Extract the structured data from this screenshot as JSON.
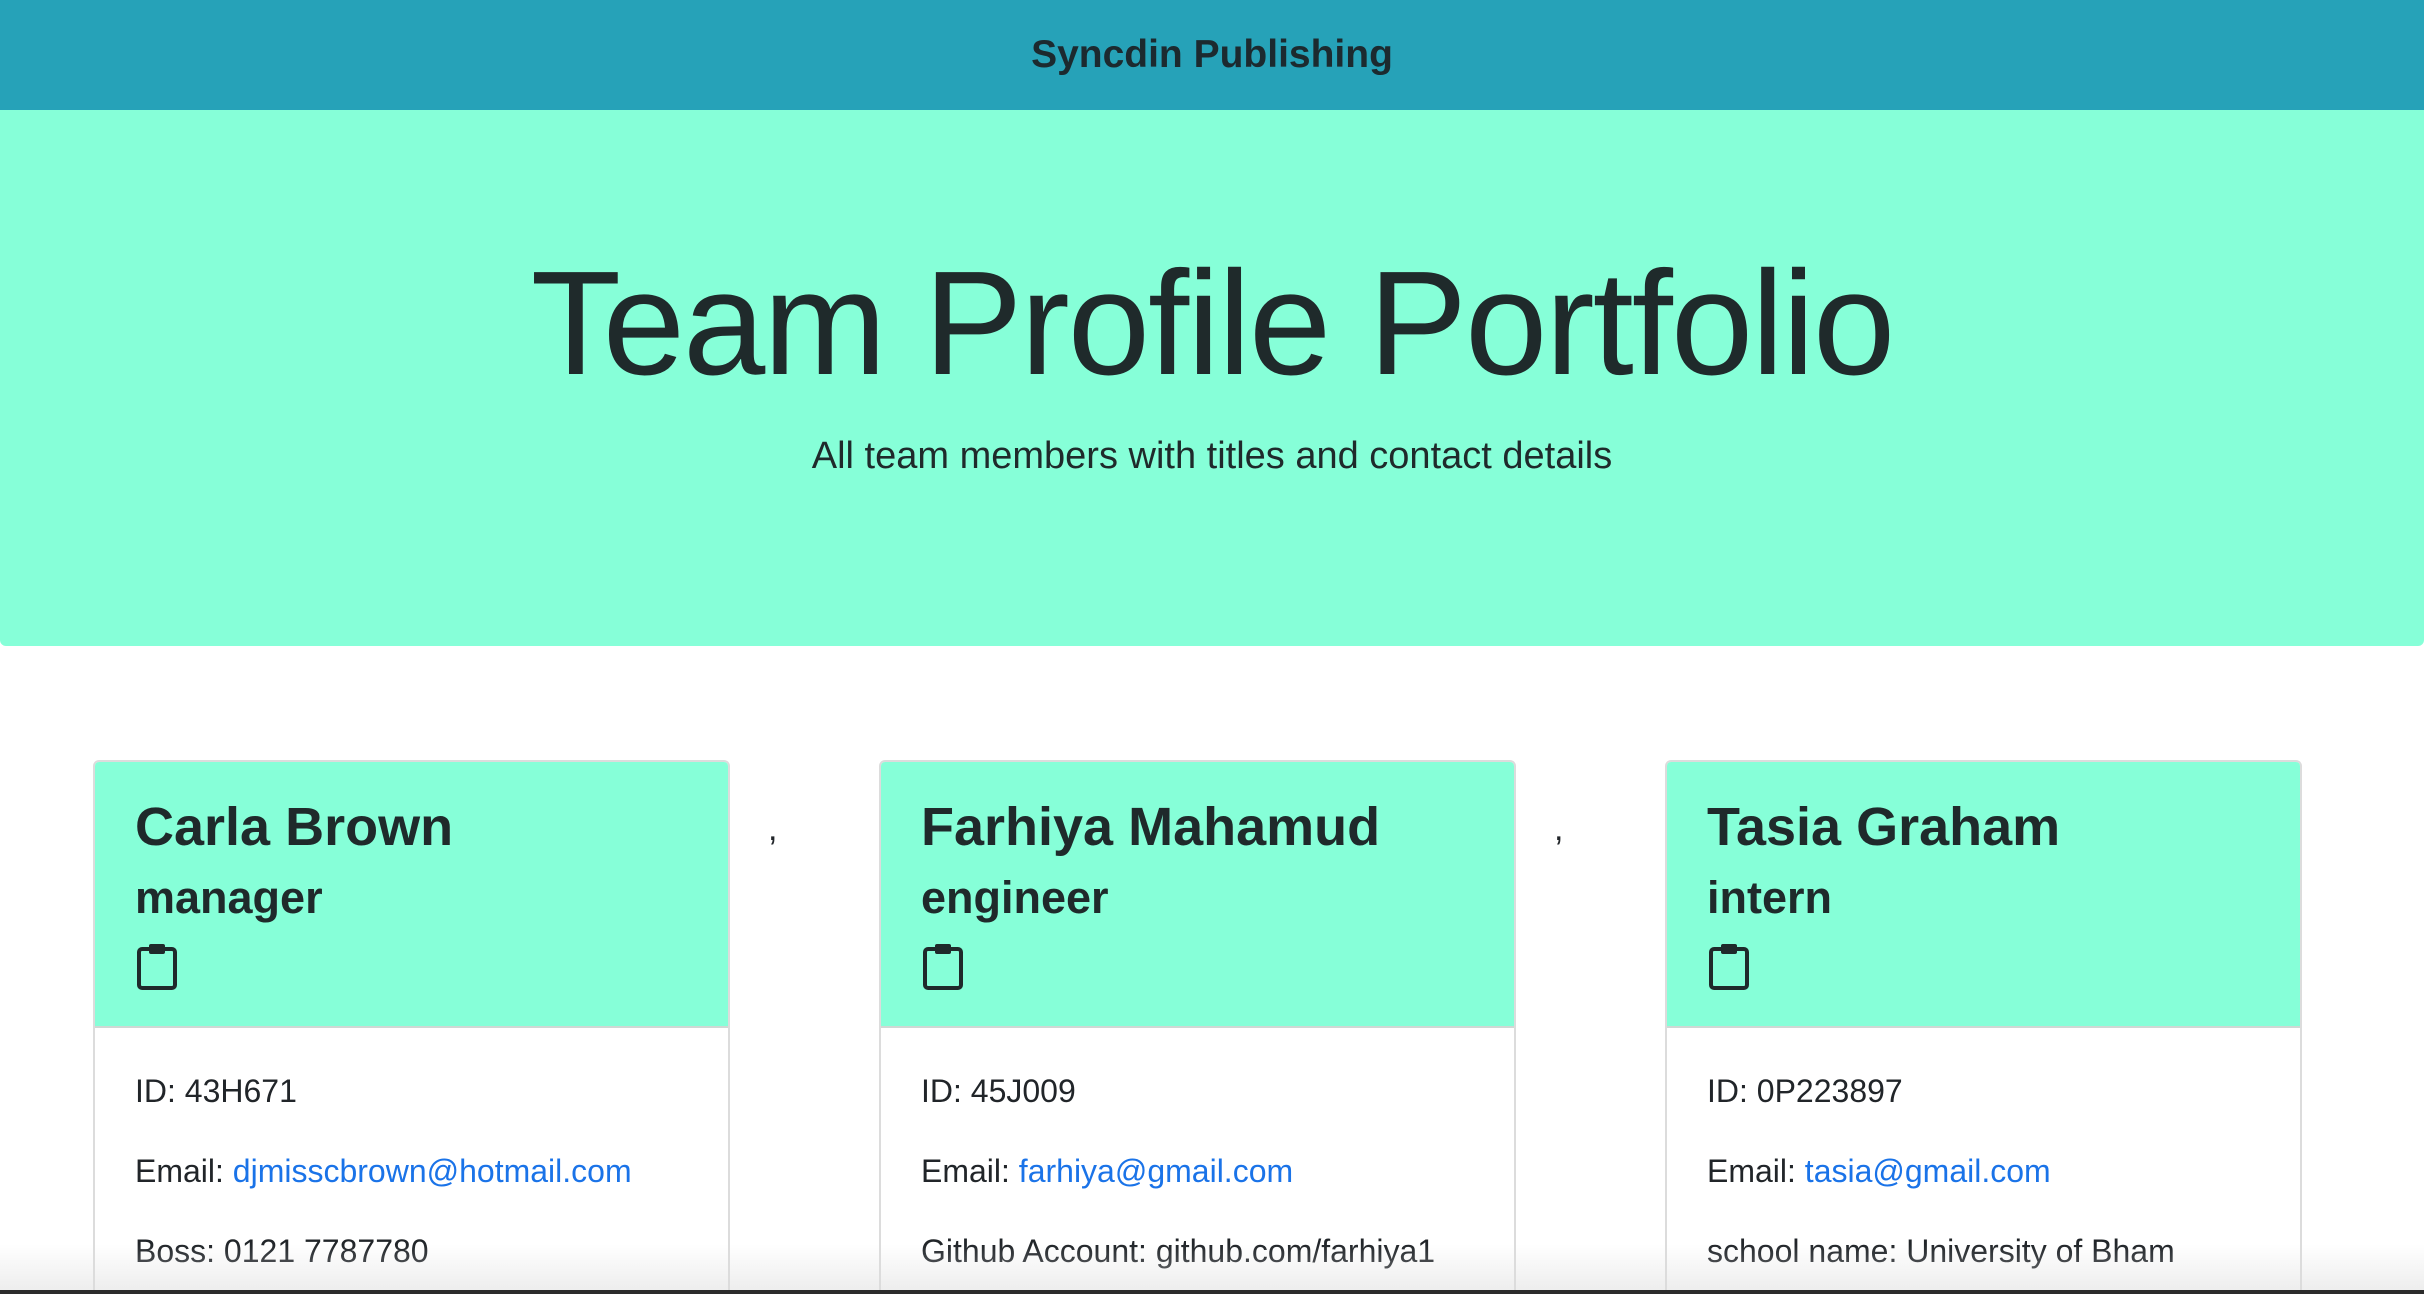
{
  "navbar": {
    "brand": "Syncdin Publishing"
  },
  "hero": {
    "title": "Team Profile Portfolio",
    "lead": "All team members with titles and contact details"
  },
  "separator": ",",
  "cards": [
    {
      "name": "Carla Brown",
      "role": "manager",
      "icon": "clipboard-icon",
      "id_label": "ID: 43H671",
      "email_label": "Email: ",
      "email": "djmisscbrown@hotmail.com",
      "extra": "Boss: 0121 7787780"
    },
    {
      "name": "Farhiya Mahamud",
      "role": "engineer",
      "icon": "clipboard-icon",
      "id_label": "ID: 45J009",
      "email_label": "Email: ",
      "email": "farhiya@gmail.com",
      "extra": "Github Account: github.com/farhiya1"
    },
    {
      "name": "Tasia Graham",
      "role": "intern",
      "icon": "clipboard-icon",
      "id_label": "ID: 0P223897",
      "email_label": "Email: ",
      "email": "tasia@gmail.com",
      "extra": "school name: University of Bham"
    }
  ],
  "colors": {
    "navbar": "#26a2b8",
    "jumbotron": "#86ffd8",
    "link": "#1a73e8"
  }
}
